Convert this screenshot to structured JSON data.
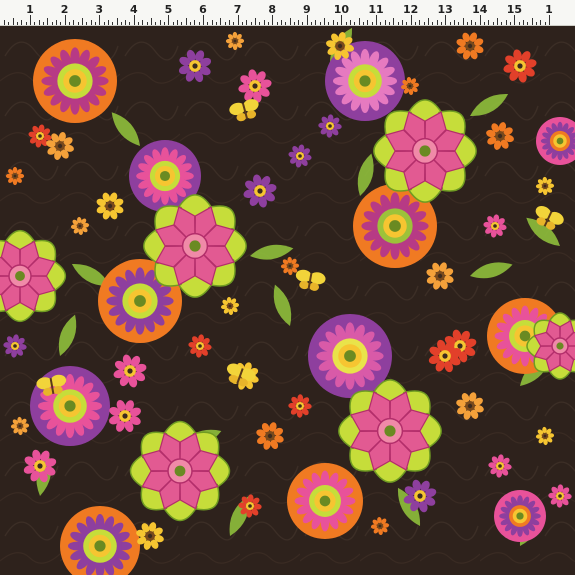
{
  "image": {
    "kind": "fabric-swatch",
    "background_color": "#2e221c",
    "palette": {
      "orange": "#f07a22",
      "pink": "#e8529a",
      "purple": "#8e3f9e",
      "lime": "#c6dd3a",
      "yellow": "#f6c531",
      "red": "#e2402a",
      "leaf_green": "#8fbf3c"
    }
  },
  "ruler": {
    "numbers": [
      "1",
      "2",
      "3",
      "4",
      "5",
      "6",
      "7",
      "8",
      "9",
      "10",
      "11",
      "12",
      "13",
      "14",
      "15",
      "1"
    ]
  },
  "motifs": {
    "large_star_flower_icon": "lime-pink-star-flower",
    "concentric_flower_icon": "orange-purple-concentric-flower",
    "small_daisy_icon": "small-daisy",
    "butterfly_icon": "yellow-butterfly"
  }
}
